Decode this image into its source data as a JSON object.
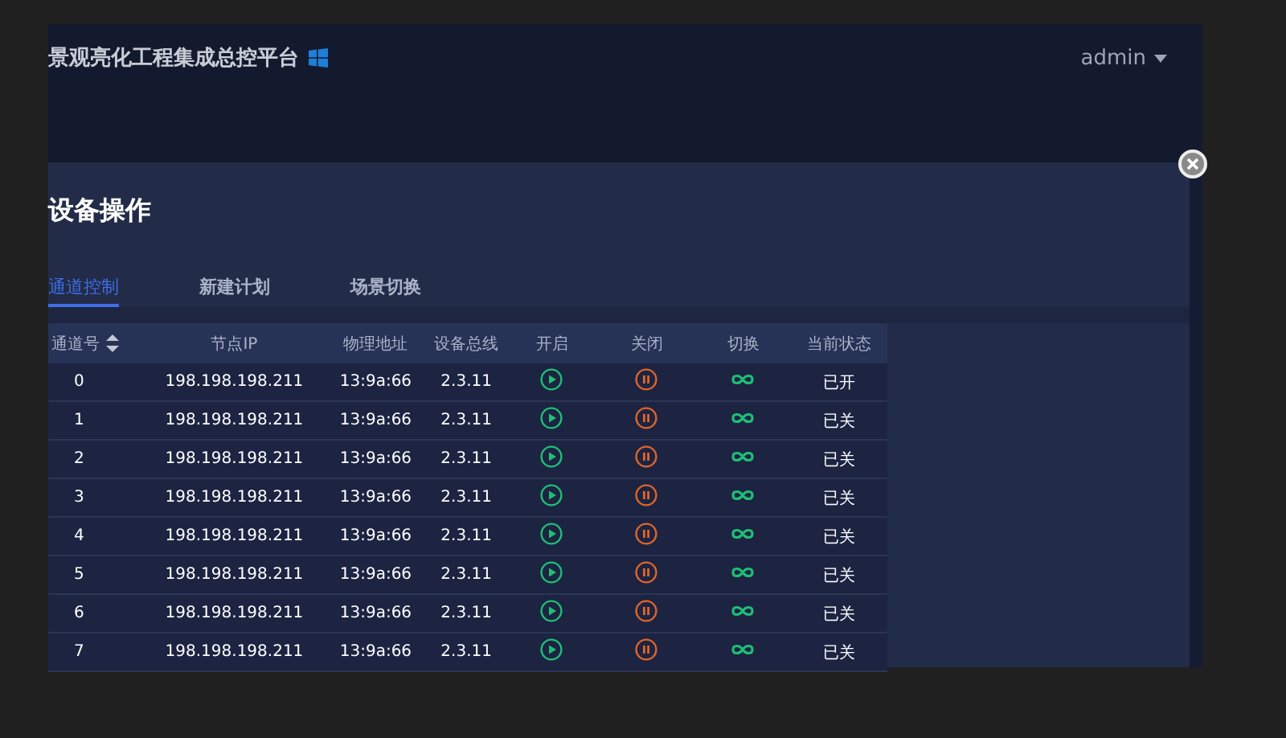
{
  "app": {
    "title": "景观亮化工程集成总控平台",
    "user": "admin"
  },
  "dialog": {
    "title": "设备操作",
    "tabs": [
      {
        "label": "通道控制",
        "selected": true
      },
      {
        "label": "新建计划",
        "selected": false
      },
      {
        "label": "场景切换",
        "selected": false
      }
    ],
    "table": {
      "columns": [
        {
          "label": "通道号",
          "sortable": true
        },
        {
          "label": "节点IP",
          "sortable": false
        },
        {
          "label": "物理地址",
          "sortable": false
        },
        {
          "label": "设备总线",
          "sortable": false
        },
        {
          "label": "开启",
          "sortable": false
        },
        {
          "label": "关闭",
          "sortable": false
        },
        {
          "label": "切换",
          "sortable": false
        },
        {
          "label": "当前状态",
          "sortable": false
        }
      ],
      "rows": [
        {
          "channel": "0",
          "ip": "198.198.198.211",
          "mac": "13:9a:66",
          "bus": "2.3.11",
          "status": "已开"
        },
        {
          "channel": "1",
          "ip": "198.198.198.211",
          "mac": "13:9a:66",
          "bus": "2.3.11",
          "status": "已关"
        },
        {
          "channel": "2",
          "ip": "198.198.198.211",
          "mac": "13:9a:66",
          "bus": "2.3.11",
          "status": "已关"
        },
        {
          "channel": "3",
          "ip": "198.198.198.211",
          "mac": "13:9a:66",
          "bus": "2.3.11",
          "status": "已关"
        },
        {
          "channel": "4",
          "ip": "198.198.198.211",
          "mac": "13:9a:66",
          "bus": "2.3.11",
          "status": "已关"
        },
        {
          "channel": "5",
          "ip": "198.198.198.211",
          "mac": "13:9a:66",
          "bus": "2.3.11",
          "status": "已关"
        },
        {
          "channel": "6",
          "ip": "198.198.198.211",
          "mac": "13:9a:66",
          "bus": "2.3.11",
          "status": "已关"
        },
        {
          "channel": "7",
          "ip": "198.198.198.211",
          "mac": "13:9a:66",
          "bus": "2.3.11",
          "status": "已关"
        }
      ]
    }
  }
}
